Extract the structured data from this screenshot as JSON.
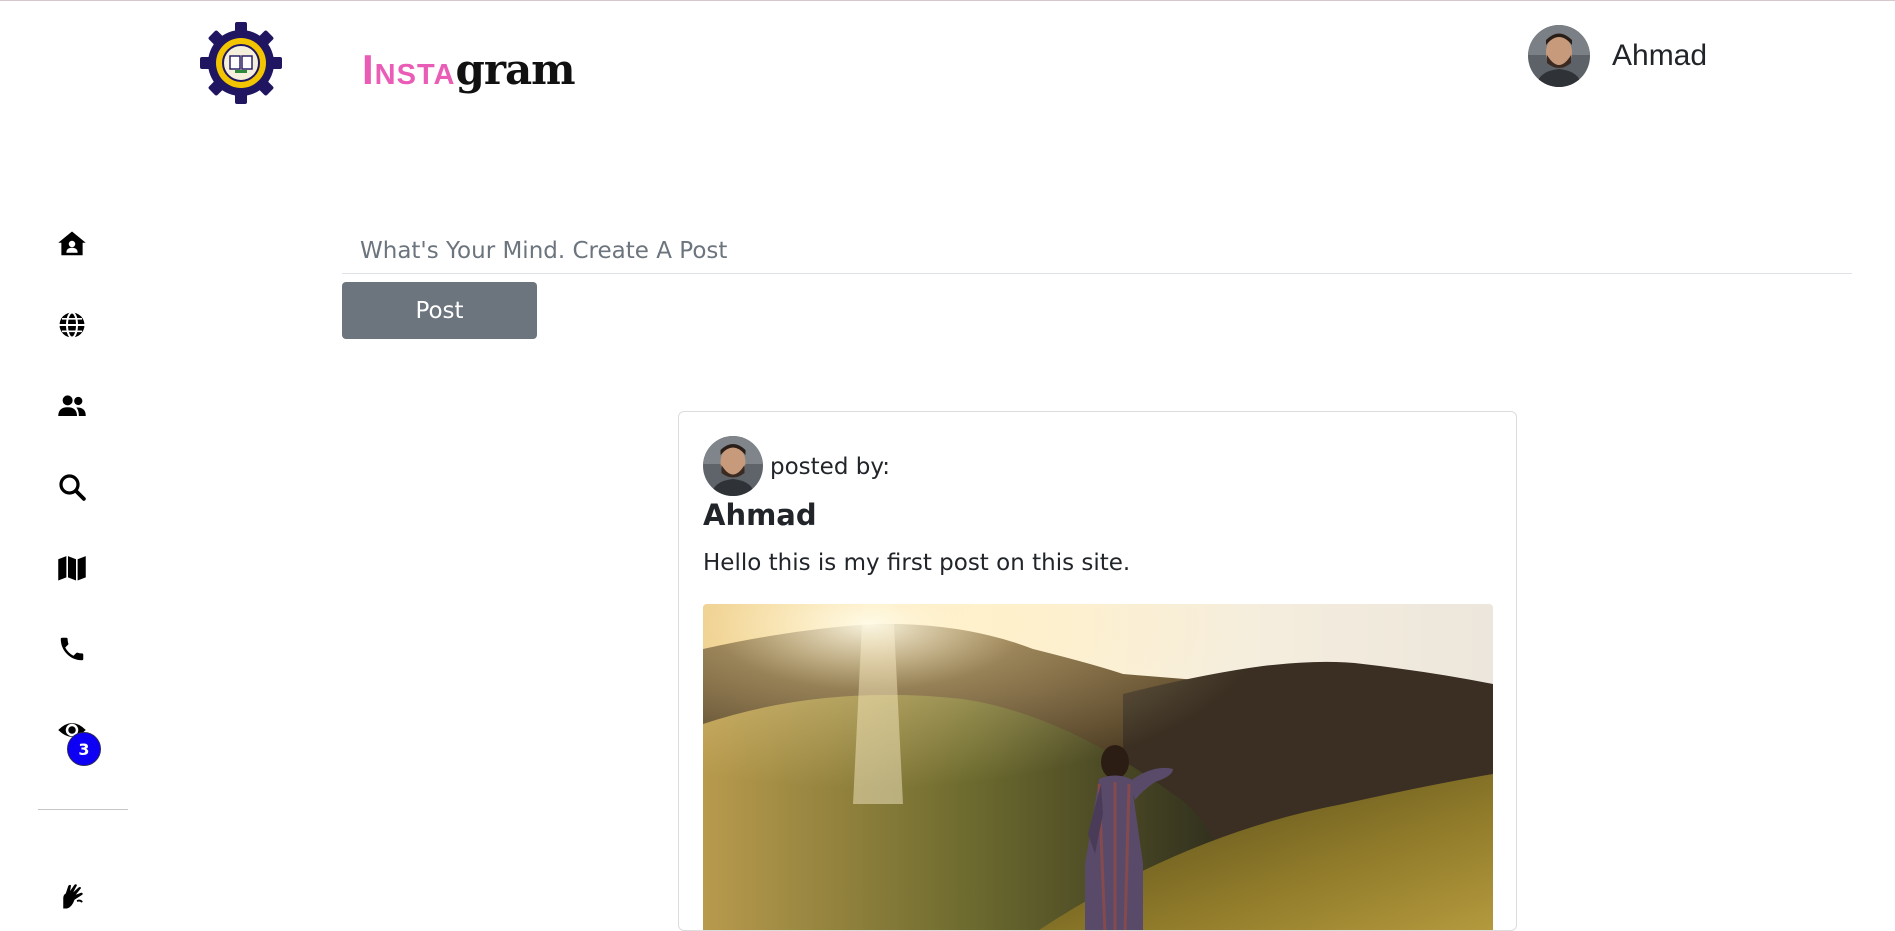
{
  "header": {
    "brand_prefix": "Insta",
    "brand_suffix": "gram",
    "user_name": "Ahmad"
  },
  "sidebar": {
    "items": [
      {
        "icon": "home-user-icon",
        "label": "Home"
      },
      {
        "icon": "globe-icon",
        "label": "Explore"
      },
      {
        "icon": "users-icon",
        "label": "Friends"
      },
      {
        "icon": "search-icon",
        "label": "Search"
      },
      {
        "icon": "map-icon",
        "label": "Map"
      },
      {
        "icon": "phone-icon",
        "label": "Contact"
      },
      {
        "icon": "eye-icon",
        "label": "Views"
      },
      {
        "icon": "sign-language-icon",
        "label": "Accessibility"
      }
    ],
    "views_badge": "3"
  },
  "composer": {
    "placeholder": "What's Your Mind. Create A Post",
    "value": "",
    "post_label": "Post"
  },
  "post": {
    "posted_by_label": "posted by:",
    "author": "Ahmad",
    "text": "Hello this is my first post on this site."
  },
  "colors": {
    "brand_pink": "#ea5db7",
    "button_gray": "#6c757d",
    "badge_blue": "#0d00f5"
  }
}
